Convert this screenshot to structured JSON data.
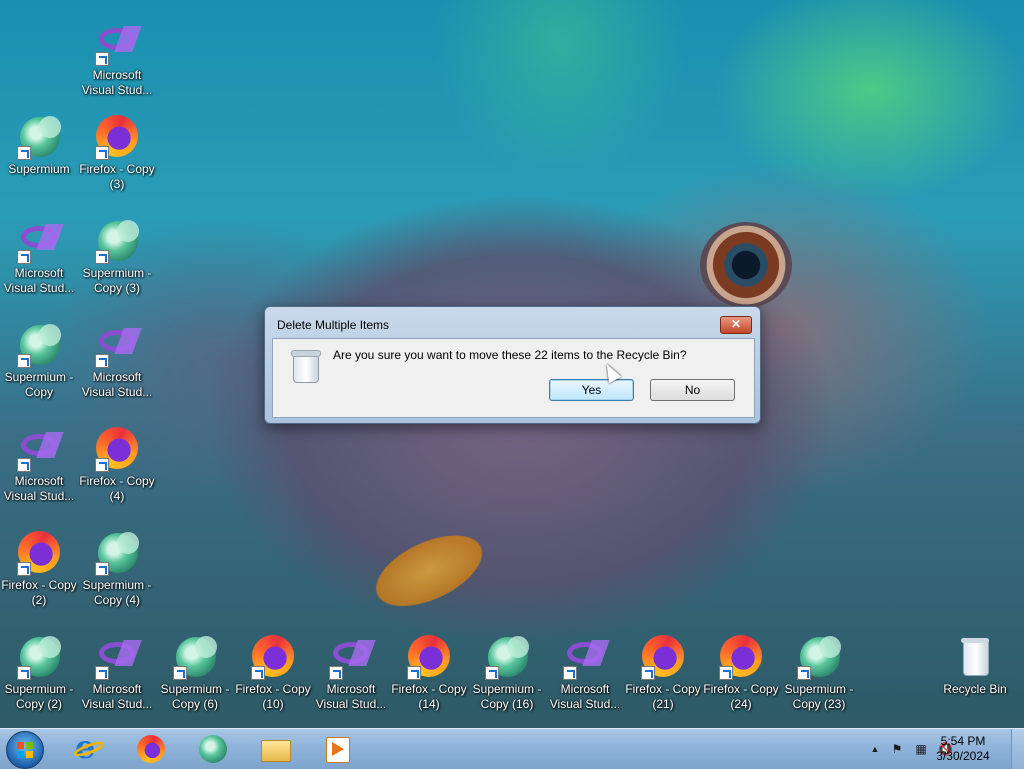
{
  "desktop": {
    "icons": [
      {
        "label": "Microsoft Visual Stud...",
        "kind": "visual-studio"
      },
      {
        "label": "Supermium",
        "kind": "supermium"
      },
      {
        "label": "Firefox - Copy (3)",
        "kind": "firefox"
      },
      {
        "label": "Microsoft Visual Stud...",
        "kind": "visual-studio"
      },
      {
        "label": "Supermium - Copy (3)",
        "kind": "supermium"
      },
      {
        "label": "Supermium - Copy",
        "kind": "supermium"
      },
      {
        "label": "Microsoft Visual Stud...",
        "kind": "visual-studio"
      },
      {
        "label": "Microsoft Visual Stud...",
        "kind": "visual-studio"
      },
      {
        "label": "Firefox - Copy (4)",
        "kind": "firefox"
      },
      {
        "label": "Firefox - Copy (2)",
        "kind": "firefox"
      },
      {
        "label": "Supermium - Copy (4)",
        "kind": "supermium"
      },
      {
        "label": "Supermium - Copy (2)",
        "kind": "supermium"
      },
      {
        "label": "Microsoft Visual Stud...",
        "kind": "visual-studio"
      },
      {
        "label": "Supermium - Copy (6)",
        "kind": "supermium"
      },
      {
        "label": "Firefox - Copy (10)",
        "kind": "firefox"
      },
      {
        "label": "Microsoft Visual Stud...",
        "kind": "visual-studio"
      },
      {
        "label": "Firefox - Copy (14)",
        "kind": "firefox"
      },
      {
        "label": "Supermium - Copy (16)",
        "kind": "supermium"
      },
      {
        "label": "Microsoft Visual Stud...",
        "kind": "visual-studio"
      },
      {
        "label": "Firefox - Copy (21)",
        "kind": "firefox"
      },
      {
        "label": "Firefox - Copy (24)",
        "kind": "firefox"
      },
      {
        "label": "Supermium - Copy (23)",
        "kind": "supermium"
      },
      {
        "label": "Recycle Bin",
        "kind": "recycle-bin"
      }
    ]
  },
  "dialog": {
    "title": "Delete Multiple Items",
    "close_label": "✕",
    "message": "Are you sure you want to move these 22 items to the Recycle Bin?",
    "yes_label": "Yes",
    "no_label": "No",
    "icon": "recycle-bin-icon"
  },
  "taskbar": {
    "pinned": [
      "start-orb",
      "internet-explorer",
      "firefox",
      "supermium",
      "file-explorer",
      "media-player"
    ],
    "tray": {
      "show_hidden_label": "▲",
      "flag_label": "⚑",
      "network_label": "▦",
      "volume_label": "🔇"
    },
    "time": "5:54 PM",
    "date": "3/30/2024"
  },
  "colors": {
    "taskbar": "#8fb3d9",
    "dialog_frame": "#aac2dc",
    "close_button": "#c2462b"
  }
}
